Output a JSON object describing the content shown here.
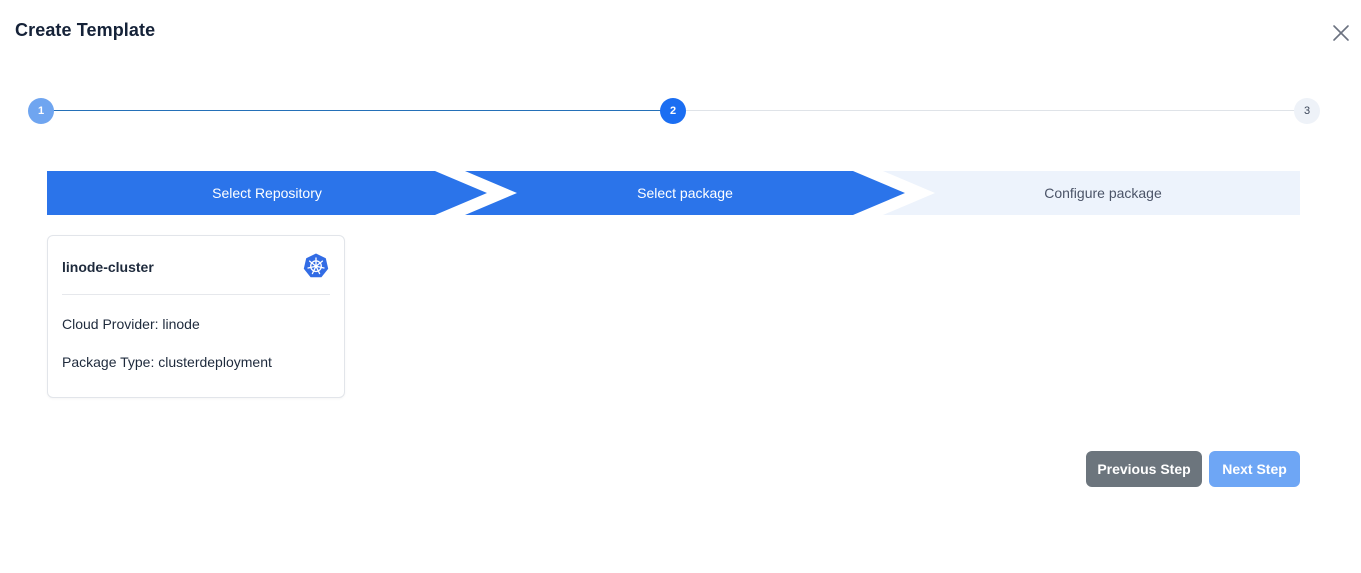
{
  "modal": {
    "title": "Create Template"
  },
  "stepper": {
    "steps": [
      {
        "number": "1",
        "state": "completed"
      },
      {
        "number": "2",
        "state": "active"
      },
      {
        "number": "3",
        "state": "pending"
      }
    ]
  },
  "breadcrumbs": {
    "items": [
      {
        "label": "Select Repository",
        "state": "done"
      },
      {
        "label": "Select package",
        "state": "active"
      },
      {
        "label": "Configure package",
        "state": "pending"
      }
    ]
  },
  "packages": [
    {
      "name": "linode-cluster",
      "icon": "kubernetes-icon",
      "cloud_provider_line": "Cloud Provider: linode",
      "package_type_line": "Package Type: clusterdeployment"
    }
  ],
  "footer": {
    "previous_label": "Previous Step",
    "next_label": "Next Step"
  },
  "colors": {
    "accent": "#1b6ef2",
    "breadcrumb_active": "#2b74ea",
    "breadcrumb_pending": "#edf3fc",
    "previous_button": "#6c757d",
    "next_button_disabled": "#6ea6f5"
  }
}
